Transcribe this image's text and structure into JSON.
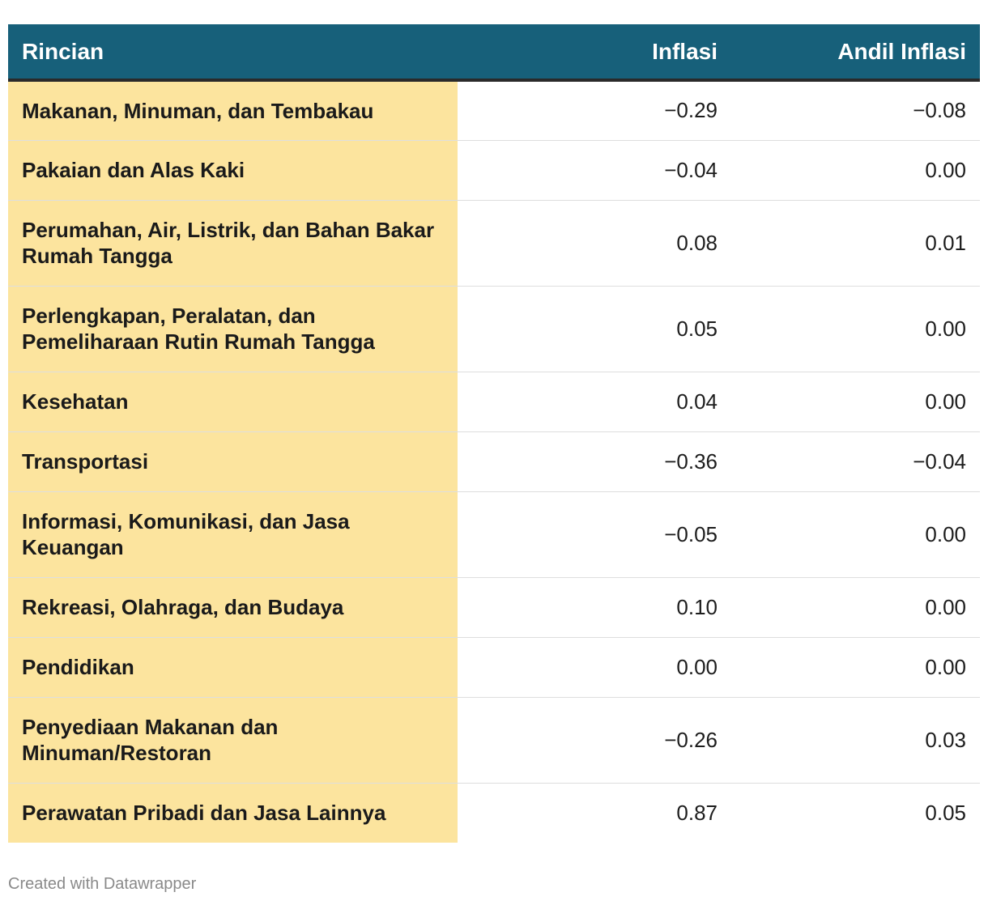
{
  "chart_data": {
    "type": "table",
    "columns": [
      "Rincian",
      "Inflasi",
      "Andil Inflasi"
    ],
    "rows": [
      {
        "rincian": "Makanan, Minuman, dan Tembakau",
        "inflasi": "−0.29",
        "andil": "−0.08"
      },
      {
        "rincian": "Pakaian dan Alas Kaki",
        "inflasi": "−0.04",
        "andil": "0.00"
      },
      {
        "rincian": "Perumahan, Air, Listrik, dan Bahan Bakar Rumah Tangga",
        "inflasi": "0.08",
        "andil": "0.01"
      },
      {
        "rincian": "Perlengkapan, Peralatan, dan Pemeliharaan Rutin Rumah Tangga",
        "inflasi": "0.05",
        "andil": "0.00"
      },
      {
        "rincian": "Kesehatan",
        "inflasi": "0.04",
        "andil": "0.00"
      },
      {
        "rincian": "Transportasi",
        "inflasi": "−0.36",
        "andil": "−0.04"
      },
      {
        "rincian": "Informasi, Komunikasi, dan Jasa Keuangan",
        "inflasi": "−0.05",
        "andil": "0.00"
      },
      {
        "rincian": "Rekreasi, Olahraga, dan Budaya",
        "inflasi": "0.10",
        "andil": "0.00"
      },
      {
        "rincian": "Pendidikan",
        "inflasi": "0.00",
        "andil": "0.00"
      },
      {
        "rincian": "Penyediaan Makanan dan Minuman/Restoran",
        "inflasi": "−0.26",
        "andil": "0.03"
      },
      {
        "rincian": "Perawatan Pribadi dan Jasa Lainnya",
        "inflasi": "0.87",
        "andil": "0.05"
      }
    ]
  },
  "colors": {
    "header_bg": "#17607a",
    "header_text": "#ffffff",
    "label_column_bg": "#fce49e",
    "row_divider": "#dedede"
  },
  "footer": {
    "credit": "Created with Datawrapper"
  }
}
